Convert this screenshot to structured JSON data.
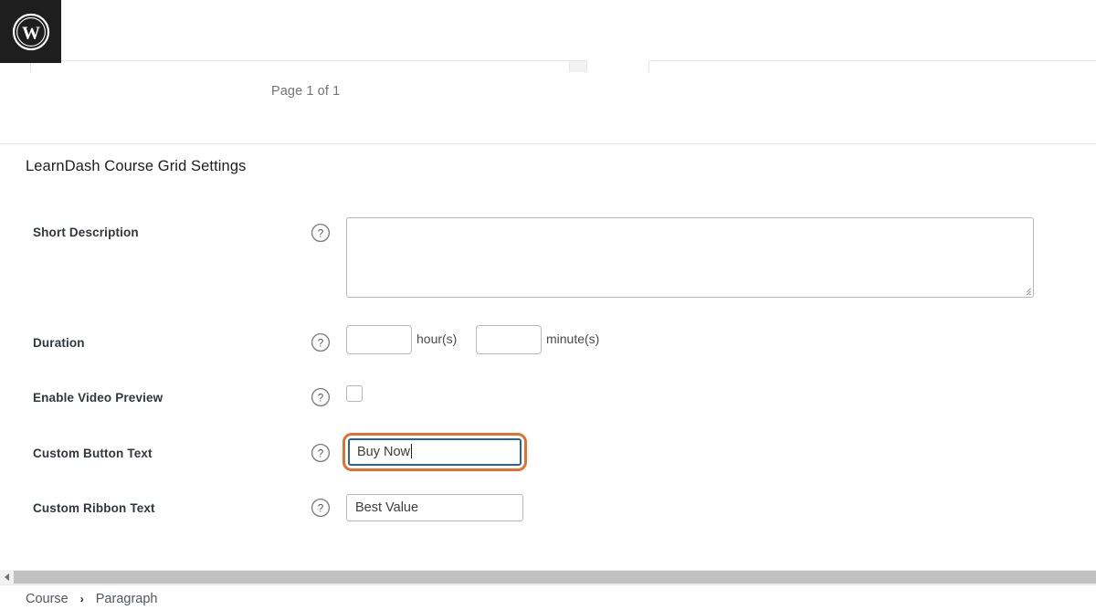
{
  "editor": {
    "logo_icon": "wordpress-logo-icon",
    "page_counter": "Page 1 of 1"
  },
  "panel": {
    "title": "LearnDash Course Grid Settings",
    "help_icon": "help-circle-icon",
    "fields": [
      {
        "label": "Short Description",
        "type": "textarea",
        "value": "",
        "help_icon": "help-circle-icon"
      },
      {
        "label": "Duration",
        "type": "duration",
        "hours_value": "",
        "hours_unit": "hour(s)",
        "minutes_value": "",
        "minutes_unit": "minute(s)",
        "help_icon": "help-circle-icon"
      },
      {
        "label": "Enable Video Preview",
        "type": "checkbox",
        "checked": false,
        "help_icon": "help-circle-icon"
      },
      {
        "label": "Custom Button Text",
        "type": "text",
        "value": "Buy Now",
        "focused": true,
        "help_icon": "help-circle-icon"
      },
      {
        "label": "Custom Ribbon Text",
        "type": "text",
        "value": "Best Value",
        "focused": false,
        "help_icon": "help-circle-icon"
      }
    ]
  },
  "footer": {
    "breadcrumb": [
      "Course",
      "Paragraph"
    ],
    "separator": "›",
    "scroll_arrow_icon": "chevron-left-icon"
  },
  "colors": {
    "focus_outline": "#e2702e",
    "focus_border": "#2a6496",
    "chrome_dark": "#1e1e1e",
    "border": "#b4b9be",
    "scrollbar_thumb": "#c1c1c1"
  }
}
